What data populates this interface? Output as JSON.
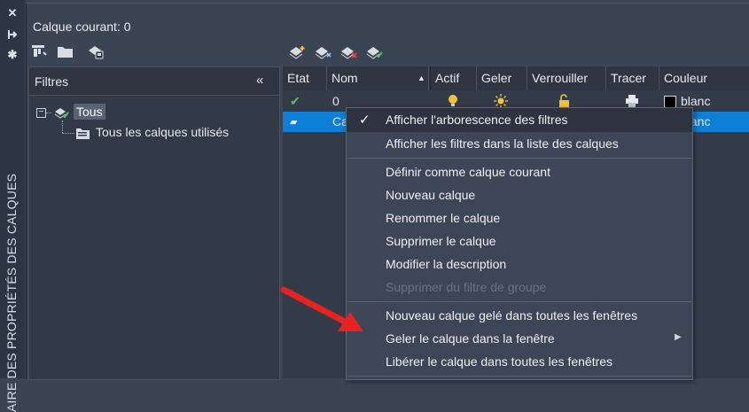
{
  "strip": {
    "close": "✕",
    "pin": "⧗",
    "settings": "✱",
    "vertical_title": "AIRE DES PROPRIÉTÉS DES CALQUES"
  },
  "header": {
    "current_layer": "Calque courant: 0"
  },
  "filters": {
    "title": "Filtres",
    "collapse": "«",
    "tree_root": "Tous",
    "tree_expander": "−",
    "tree_child": "Tous les calques utilisés"
  },
  "table": {
    "columns": [
      "Etat",
      "Nom",
      "Actif",
      "Geler",
      "Verrouiller",
      "Tracer",
      "Couleur"
    ],
    "rows": [
      {
        "status": "✔",
        "name": "0",
        "color": "blanc"
      },
      {
        "status": "▰",
        "name": "Ca",
        "color": "blanc"
      }
    ]
  },
  "context_menu": {
    "items": [
      {
        "label": "Afficher l'arborescence des filtres",
        "checked": true,
        "enabled": true
      },
      {
        "label": "Afficher les filtres dans la liste des calques",
        "enabled": true
      },
      {
        "label": "Définir comme calque courant",
        "enabled": true
      },
      {
        "label": "Nouveau calque",
        "enabled": true
      },
      {
        "label": "Renommer le calque",
        "enabled": true
      },
      {
        "label": "Supprimer le calque",
        "enabled": true
      },
      {
        "label": "Modifier la description",
        "enabled": true
      },
      {
        "label": "Supprimer du filtre de groupe",
        "enabled": false
      },
      {
        "label": "Nouveau calque gelé dans toutes les fenêtres",
        "enabled": true
      },
      {
        "label": "Geler le calque dans la fenêtre",
        "enabled": true,
        "submenu": true
      },
      {
        "label": "Libérer le calque dans toutes les fenêtres",
        "enabled": true
      }
    ],
    "check_glyph": "✓",
    "submenu_glyph": "▶"
  },
  "colors": {
    "annotation_arrow": "#e8231f",
    "selected_row": "#0e7fd6",
    "panel": "#3b4453"
  }
}
